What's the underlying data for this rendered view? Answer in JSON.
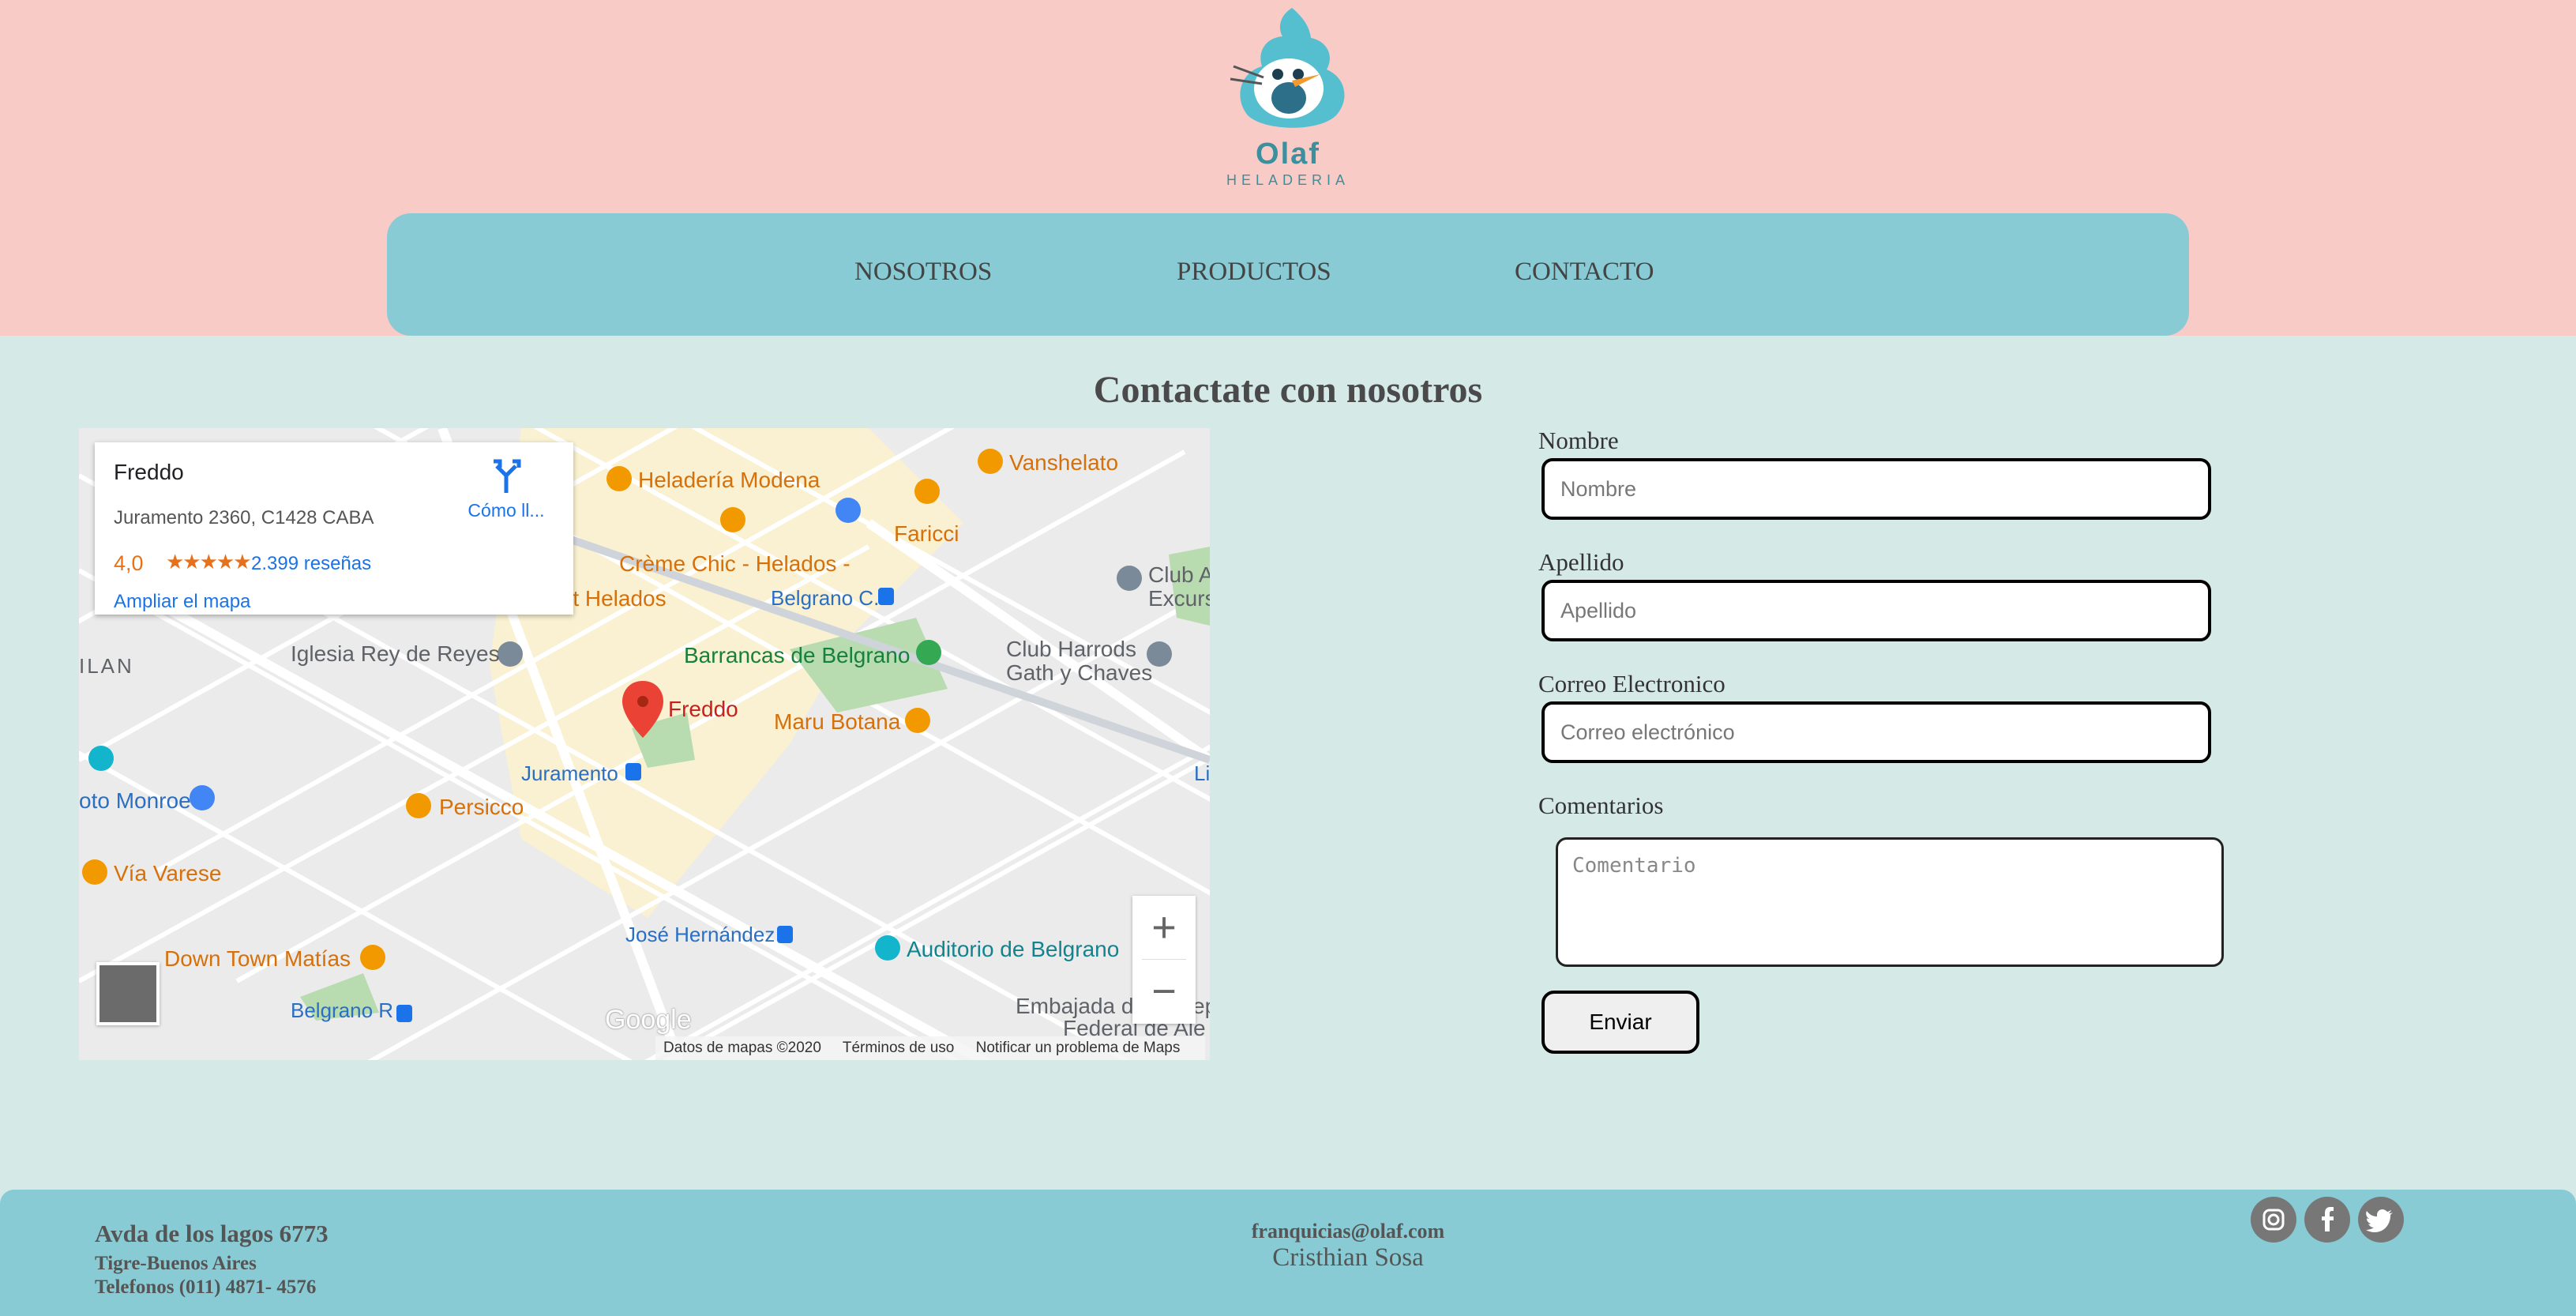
{
  "brand": {
    "name": "Olaf",
    "tagline": "HELADERIA"
  },
  "nav": {
    "items": [
      "NOSOTROS",
      "PRODUCTOS",
      "CONTACTO"
    ]
  },
  "page": {
    "title": "Contactate con nosotros"
  },
  "map": {
    "place": {
      "name": "Freddo",
      "address": "Juramento 2360, C1428 CABA",
      "rating": "4,0",
      "stars": "★★★★★",
      "reviews": "2.399 reseñas",
      "directions_label": "Cómo ll...",
      "expand_label": "Ampliar el mapa"
    },
    "labels": {
      "heladeria_modena": "Heladería Modena",
      "vanshelato": "Vanshelato",
      "faricci": "Faricci",
      "creme_chic": "Crème Chic - Helados -",
      "rt_helados": "rt Helados",
      "belgrano_c": "Belgrano C.",
      "club_a": "Club A",
      "excurs": "Excurs",
      "club_harrods": "Club Harrods",
      "gath_chaves": "Gath y Chaves",
      "iglesia": "Iglesia Rey de Reyes",
      "barrancas": "Barrancas de Belgrano",
      "ilan": "ILAN",
      "freddo_pin": "Freddo",
      "maru_botana": "Maru Botana",
      "juramento": "Juramento",
      "li": "Li",
      "oto_monroe": "oto Monroe",
      "persicco": "Persicco",
      "via_varese": "Vía Varese",
      "jose_hernandez": "José Hernández",
      "auditorio": "Auditorio de Belgrano",
      "down_town": "Down Town Matías",
      "embajada_1": "Embajada de ",
      "embajada_1b": "ep",
      "embajada_2": "Federal de Ale",
      "belgrano_r": "Belgrano R"
    },
    "zoom_in": "+",
    "zoom_out": "−",
    "google": "Google",
    "attribution": [
      "Datos de mapas ©2020",
      "Términos de uso",
      "Notificar un problema de Maps"
    ]
  },
  "form": {
    "nombre_label": "Nombre",
    "nombre_placeholder": "Nombre",
    "apellido_label": "Apellido",
    "apellido_placeholder": "Apellido",
    "correo_label": "Correo Electronico",
    "correo_placeholder": "Correo electrónico",
    "comentarios_label": "Comentarios",
    "comentario_placeholder": "Comentario",
    "submit_label": "Enviar"
  },
  "footer": {
    "address": "Avda de los lagos 6773",
    "city": "Tigre-Buenos Aires",
    "phone": "Telefonos (011) 4871- 4576",
    "email": "franquicias@olaf.com",
    "author": "Cristhian Sosa",
    "social": [
      "instagram-icon",
      "facebook-icon",
      "twitter-icon"
    ]
  },
  "colors": {
    "header_bg": "#f8cbc7",
    "nav_bg": "#88cbd5",
    "body_bg": "#d5e9e7"
  }
}
